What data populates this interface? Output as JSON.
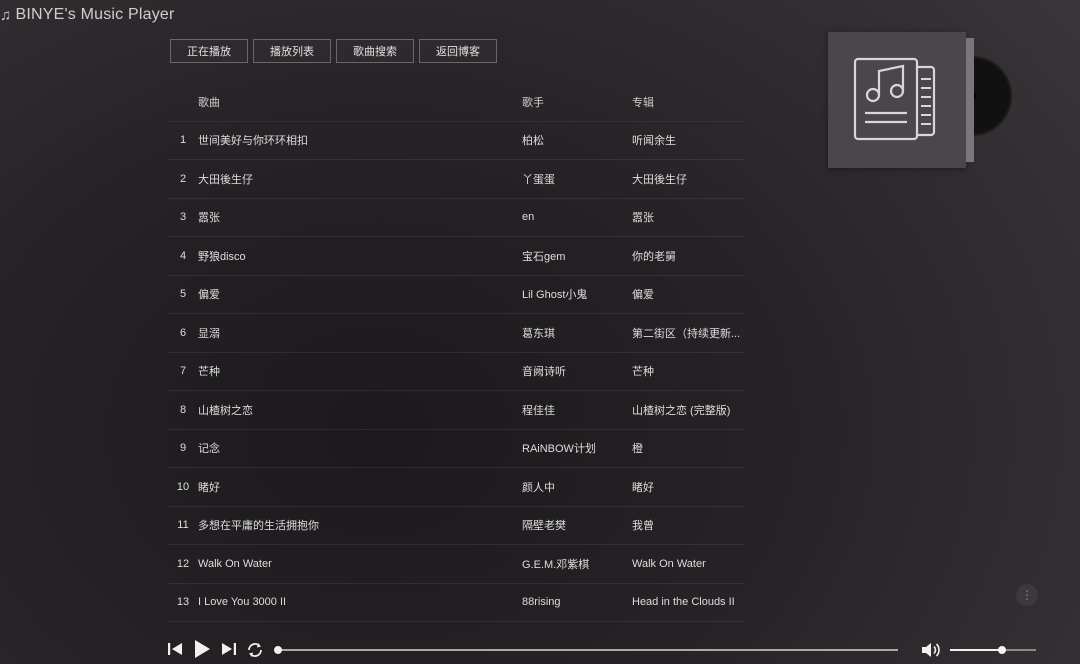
{
  "app": {
    "title": "BINYE's Music Player",
    "title_icon": "music-note-icon"
  },
  "nav": [
    {
      "label": "正在播放"
    },
    {
      "label": "播放列表"
    },
    {
      "label": "歌曲搜索"
    },
    {
      "label": "返回博客"
    }
  ],
  "list": {
    "headers": {
      "title": "歌曲",
      "artist": "歌手",
      "album": "专辑"
    },
    "rows": [
      {
        "num": "1",
        "title": "世间美好与你环环相扣",
        "artist": "柏松",
        "album": "听闻余生"
      },
      {
        "num": "2",
        "title": "大田後生仔",
        "artist": "丫蛋蛋",
        "album": "大田後生仔"
      },
      {
        "num": "3",
        "title": "嚣张",
        "artist": "en",
        "album": "嚣张"
      },
      {
        "num": "4",
        "title": "野狼disco",
        "artist": "宝石gem",
        "album": "你的老舅"
      },
      {
        "num": "5",
        "title": "偏爱",
        "artist": "Lil Ghost小鬼",
        "album": "偏爱"
      },
      {
        "num": "6",
        "title": "显溺",
        "artist": "葛东琪",
        "album": "第二街区（持续更新..."
      },
      {
        "num": "7",
        "title": "芒种",
        "artist": "音阙诗听",
        "album": "芒种"
      },
      {
        "num": "8",
        "title": "山楂树之恋",
        "artist": "程佳佳",
        "album": "山楂树之恋 (完整版)"
      },
      {
        "num": "9",
        "title": "记念",
        "artist": "RAiNBOW计划",
        "album": "橙"
      },
      {
        "num": "10",
        "title": "睹好",
        "artist": "颜人中",
        "album": "睹好"
      },
      {
        "num": "11",
        "title": "多想在平庸的生活拥抱你",
        "artist": "隔壁老樊",
        "album": "我曾"
      },
      {
        "num": "12",
        "title": "Walk On Water",
        "artist": "G.E.M.邓紫棋",
        "album": "Walk On Water"
      },
      {
        "num": "13",
        "title": "I Love You 3000 II",
        "artist": "88rising",
        "album": "Head in the Clouds II"
      }
    ]
  },
  "cover": {
    "icon": "music-document-icon",
    "color": "#4a464b"
  },
  "player": {
    "icons": [
      "prev-icon",
      "play-icon",
      "next-icon",
      "repeat-icon",
      "volume-icon",
      "more-icon"
    ],
    "progress": 0.0,
    "volume": 0.6
  }
}
